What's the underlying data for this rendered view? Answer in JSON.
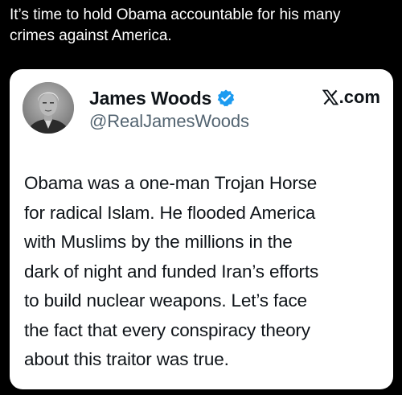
{
  "post": {
    "caption_lines": [
      "It’s time to hold Obama accountable for his many",
      "crimes against America."
    ]
  },
  "tweet_card": {
    "author": {
      "display_name": "James Woods",
      "handle": "@RealJamesWoods",
      "verified": true
    },
    "brand": {
      "label": ".com",
      "icon": "x-logo-icon"
    },
    "text_lines": [
      "Obama was a one-man Trojan Horse",
      "for radical Islam. He flooded America",
      "with Muslims by the millions in the",
      "dark of night and funded Iran’s efforts",
      "to build nuclear weapons. Let’s face",
      "the fact that every conspiracy theory",
      "about this traitor was true."
    ]
  },
  "colors": {
    "page_background": "#000000",
    "caption_text": "#ffffff",
    "card_background": "#ffffff",
    "primary_text": "#0f1419",
    "secondary_text": "#536471",
    "verified_badge": "#1d9bf0"
  }
}
